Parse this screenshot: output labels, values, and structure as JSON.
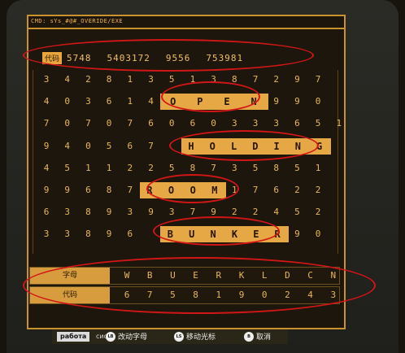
{
  "header": {
    "cmd": "CMD: sYs_#@#_OVERIDE/EXE"
  },
  "code_line": {
    "tag": "代码",
    "values": [
      "5748",
      "5403172",
      "9556",
      "753981"
    ]
  },
  "grid": {
    "rows": [
      {
        "digits": [
          "3",
          "4",
          "2",
          "8",
          "1",
          "3",
          "5",
          "1",
          "3",
          "8",
          "7",
          "2",
          "9",
          "7"
        ]
      },
      {
        "digits": [
          "4",
          "0",
          "3",
          "6",
          "1",
          "4",
          "",
          "",
          "",
          "",
          "",
          "9",
          "9",
          "0"
        ],
        "word": "OPEN",
        "word_start": 6,
        "word_len": 5
      },
      {
        "digits": [
          "7",
          "0",
          "7",
          "0",
          "7",
          "6",
          "0",
          "6",
          "0",
          "3",
          "3",
          "3",
          "6",
          "5",
          "1"
        ]
      },
      {
        "digits": [
          "9",
          "4",
          "0",
          "5",
          "6",
          "7",
          "",
          "",
          "",
          "",
          "",
          "",
          "",
          "7"
        ],
        "word": "HOLDING",
        "word_start": 7,
        "word_len": 7
      },
      {
        "digits": [
          "4",
          "5",
          "1",
          "1",
          "2",
          "2",
          "5",
          "8",
          "7",
          "3",
          "5",
          "8",
          "5",
          "1"
        ]
      },
      {
        "digits": [
          "9",
          "9",
          "6",
          "8",
          "7",
          "",
          "",
          "",
          "",
          "1",
          "7",
          "6",
          "2",
          "2"
        ],
        "word": "ROOM",
        "word_start": 5,
        "word_len": 4
      },
      {
        "digits": [
          "6",
          "3",
          "8",
          "9",
          "3",
          "9",
          "3",
          "7",
          "9",
          "2",
          "2",
          "4",
          "5",
          "2"
        ]
      },
      {
        "digits": [
          "3",
          "3",
          "8",
          "9",
          "6",
          "",
          "",
          "",
          "",
          "",
          "",
          "1",
          "9",
          "0"
        ],
        "word": "BUNKER",
        "word_start": 6,
        "word_len": 6
      }
    ]
  },
  "table": {
    "letters_label": "字母",
    "letters": [
      "W",
      "B",
      "U",
      "E",
      "R",
      "K",
      "L",
      "D",
      "C",
      "N"
    ],
    "codes_label": "代码",
    "codes": [
      "6",
      "7",
      "5",
      "8",
      "1",
      "9",
      "0",
      "2",
      "4",
      "3"
    ]
  },
  "footer": {
    "tab_label": "работа",
    "tab_tail": "сис",
    "hint1_btn": "LB",
    "hint1_label": "改动字母",
    "hint2_btn": "LS",
    "hint2_label": "移动光标",
    "hint3_btn": "B",
    "hint3_label": "取消"
  },
  "colors": {
    "accent": "#e6a844",
    "annotation": "#d21616"
  }
}
